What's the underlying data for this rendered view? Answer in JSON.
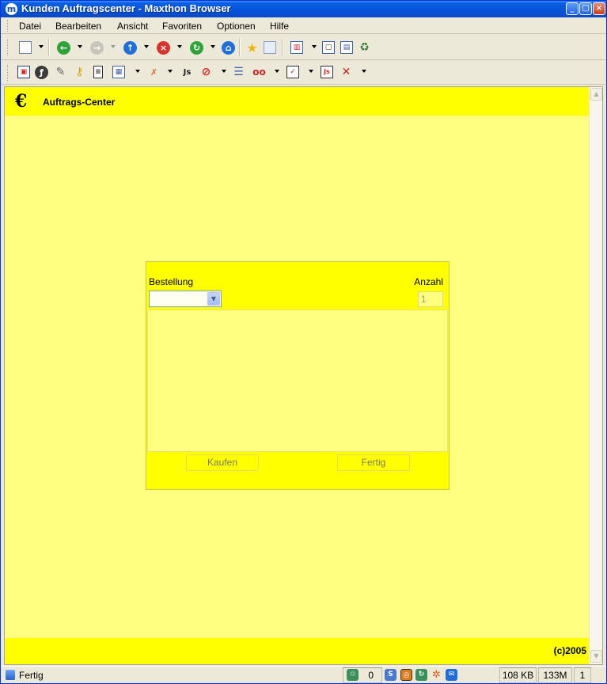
{
  "window": {
    "title": "Kunden Auftragscenter - Maxthon Browser",
    "app_icon": "maxthon-logo-icon",
    "controls": [
      "minimize-icon",
      "maximize-icon",
      "close-icon"
    ]
  },
  "menubar": {
    "items": [
      "Datei",
      "Bearbeiten",
      "Ansicht",
      "Favoriten",
      "Optionen",
      "Hilfe"
    ]
  },
  "toolbar_icons": {
    "row1": [
      "new-page-icon",
      "back-icon",
      "forward-icon",
      "up-icon",
      "stop-icon",
      "refresh-icon",
      "home-icon",
      "favorites-star-icon",
      "collection-icon",
      "layout-icon",
      "fullscreen-icon",
      "split-view-icon",
      "recycle-icon"
    ],
    "row2": [
      "save-icon",
      "flash-icon",
      "attachment-icon",
      "key-icon",
      "notes-icon",
      "calendar-icon",
      "ad-block-icon",
      "javascript-icon",
      "popup-block-icon",
      "list-icon",
      "binoculars-icon",
      "checkbox-icon",
      "javascript-toggle-icon",
      "x-block-icon"
    ]
  },
  "page": {
    "header_title": "Auftrags-Center",
    "header_icon": "euro-icon",
    "footer": "(c)2005",
    "colors": {
      "header_bg": "#ffff00",
      "page_bg": "#ffff80"
    }
  },
  "order_form": {
    "bestellung_label": "Bestellung",
    "anzahl_label": "Anzahl",
    "bestellung_selected": "",
    "anzahl_value": "1",
    "buy_button": "Kaufen",
    "done_button": "Fertig"
  },
  "statusbar": {
    "status_text": "Fertig",
    "counter": "0",
    "memory_page": "108 KB",
    "memory_total": "133M",
    "window_count": "1"
  }
}
